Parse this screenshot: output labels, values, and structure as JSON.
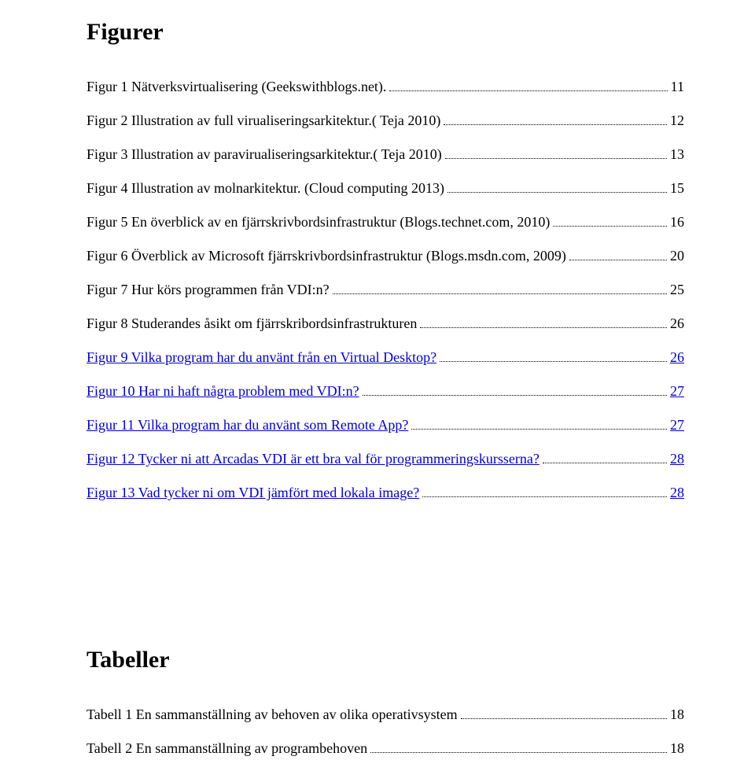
{
  "headings": {
    "figures": "Figurer",
    "tables": "Tabeller"
  },
  "figures": [
    {
      "label": "Figur 1 Nätverksvirtualisering (Geekswithblogs.net).",
      "page": "11",
      "link": false
    },
    {
      "label": "Figur 2 Illustration av full virualiseringsarkitektur.( Teja 2010)",
      "page": "12",
      "link": false
    },
    {
      "label": "Figur 3 Illustration av paravirualiseringsarkitektur.( Teja 2010)",
      "page": "13",
      "link": false
    },
    {
      "label": "Figur 4 Illustration av molnarkitektur. (Cloud computing 2013)",
      "page": "15",
      "link": false
    },
    {
      "label": "Figur 5 En överblick av en fjärrskrivbordsinfrastruktur (Blogs.technet.com, 2010)",
      "page": "16",
      "link": false
    },
    {
      "label": "Figur 6 Överblick av Microsoft fjärrskrivbordsinfrastruktur (Blogs.msdn.com, 2009)",
      "page": "20",
      "link": false
    },
    {
      "label": "Figur 7 Hur körs programmen från VDI:n?",
      "page": "25",
      "link": false
    },
    {
      "label": "Figur 8 Studerandes åsikt om fjärrskribordsinfrastrukturen",
      "page": "26",
      "link": false
    },
    {
      "label": "Figur 9 Vilka program har du använt från en Virtual Desktop?",
      "page": "26",
      "link": true
    },
    {
      "label": "Figur 10 Har ni haft några problem med VDI:n?",
      "page": "27",
      "link": true
    },
    {
      "label": "Figur 11 Vilka program har du använt som Remote App?",
      "page": "27",
      "link": true
    },
    {
      "label": "Figur 12 Tycker ni att Arcadas VDI är ett bra val för programmeringskursserna?",
      "page": "28",
      "link": true
    },
    {
      "label": "Figur 13 Vad tycker ni om VDI jämfört med lokala image?",
      "page": "28",
      "link": true
    }
  ],
  "tables": [
    {
      "label": "Tabell 1 En sammanställning av behoven av olika operativsystem",
      "page": "18",
      "link": false
    },
    {
      "label": "Tabell 2 En sammanställning av programbehoven",
      "page": "18",
      "link": false
    }
  ]
}
